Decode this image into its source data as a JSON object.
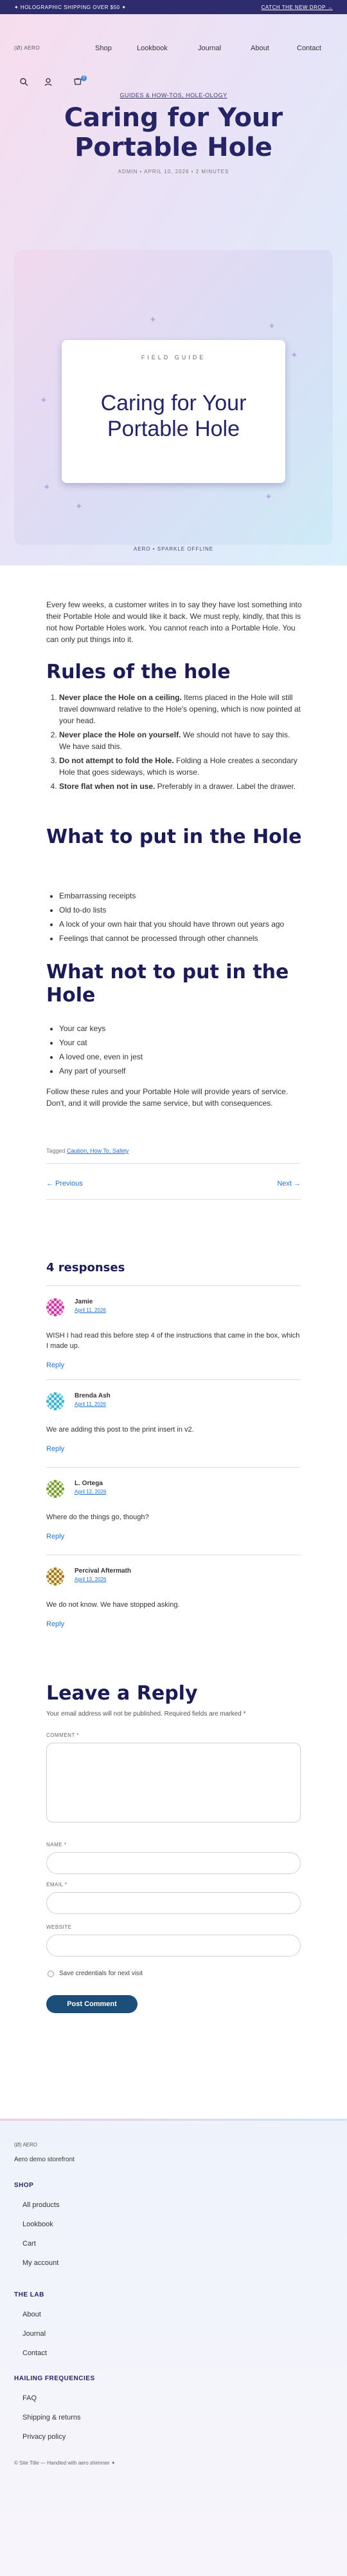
{
  "banner": {
    "left": "✦ HOLOGRAPHIC SHIPPING OVER $50 ✦",
    "right": "CATCH THE NEW DROP →"
  },
  "header": {
    "logo": "(Ø) AERO",
    "nav": [
      "Shop",
      "Lookbook",
      "Journal",
      "About",
      "Contact"
    ],
    "cart_count": "0"
  },
  "post": {
    "categories": "GUIDES & HOW-TOS, HOLE-OLOGY",
    "title": "Caring for Your Portable Hole",
    "meta": "ADMIN  •  APRIL 10, 2026  •  2 MINUTES",
    "image_kicker": "FIELD GUIDE",
    "image_title": "Caring for Your Portable Hole",
    "image_caption": "AERO  •  SPARKLE OFFLINE",
    "intro": "Every few weeks, a customer writes in to say they have lost something into their Portable Hole and would like it back. We must reply, kindly, that this is not how Portable Holes work. You cannot reach into a Portable Hole. You can only put things into it.",
    "h_rules": "Rules of the hole",
    "rules": [
      {
        "b": "Never place the Hole on a ceiling.",
        "t": " Items placed in the Hole will still travel downward relative to the Hole's opening, which is now pointed at your head."
      },
      {
        "b": "Never place the Hole on yourself.",
        "t": " We should not have to say this. We have said this."
      },
      {
        "b": "Do not attempt to fold the Hole.",
        "t": " Folding a Hole creates a secondary Hole that goes sideways, which is worse."
      },
      {
        "b": "Store flat when not in use.",
        "t": " Preferably in a drawer. Label the drawer."
      }
    ],
    "h_put": "What to put in the Hole",
    "put": [
      "Embarrassing receipts",
      "Old to-do lists",
      "A lock of your own hair that you should have thrown out years ago",
      "Feelings that cannot be processed through other channels"
    ],
    "h_not": "What not to put in the Hole",
    "not": [
      "Your car keys",
      "Your cat",
      "A loved one, even in jest",
      "Any part of yourself"
    ],
    "closing": "Follow these rules and your Portable Hole will provide years of service. Don't, and it will provide the same service, but with consequences.",
    "tagged_label": "Tagged",
    "tags": "Caution, How To, Safety",
    "prev": "← Previous",
    "next": "Next →"
  },
  "responses": {
    "heading": "4 responses",
    "items": [
      {
        "name": "Jamie",
        "date": "April 11, 2026",
        "text": "WISH I had read this before step 4 of the instructions that came in the box, which I made up.",
        "reply": "Reply",
        "color": "#c93aa3"
      },
      {
        "name": "Brenda Ash",
        "date": "April 11, 2026",
        "text": "We are adding this post to the print insert in v2.",
        "reply": "Reply",
        "color": "#3fb4c8"
      },
      {
        "name": "L. Ortega",
        "date": "April 12, 2026",
        "text": "Where do the things go, though?",
        "reply": "Reply",
        "color": "#7a9a3a"
      },
      {
        "name": "Percival Aftermath",
        "date": "April 13, 2026",
        "text": "We do not know. We have stopped asking.",
        "reply": "Reply",
        "color": "#a07a20"
      }
    ]
  },
  "reply_form": {
    "heading": "Leave a Reply",
    "note": "Your email address will not be published. Required fields are marked *",
    "comment_label": "COMMENT *",
    "name_label": "NAME *",
    "email_label": "EMAIL *",
    "website_label": "WEBSITE",
    "save_label": "Save credentials for next visit",
    "submit": "Post Comment"
  },
  "footer": {
    "logo": "(Ø) AERO",
    "tagline": "Aero demo storefront",
    "shop_heading": "SHOP",
    "shop": [
      "All products",
      "Lookbook",
      "Cart",
      "My account"
    ],
    "lab_heading": "THE LAB",
    "lab": [
      "About",
      "Journal",
      "Contact"
    ],
    "hail_heading": "HAILING FREQUENCIES",
    "hail": [
      "FAQ",
      "Shipping & returns",
      "Privacy policy"
    ],
    "copyright": "© Site Title — Handled with aero shimmer ✦"
  }
}
